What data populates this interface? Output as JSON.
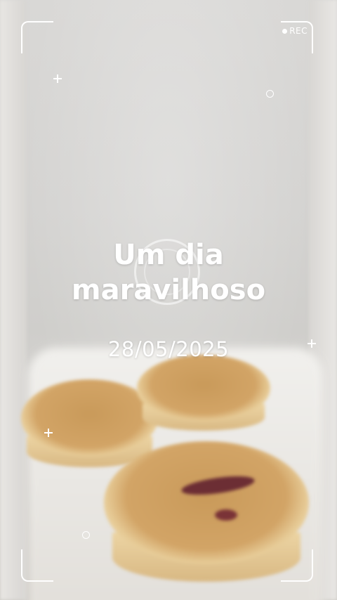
{
  "overlay": {
    "rec_label": "REC",
    "title_line1": "Um dia",
    "title_line2": "maravilhoso",
    "date": "28/05/2025"
  },
  "colors": {
    "text": "#ffffff",
    "crust": "#d2a466",
    "jam": "#6c2e34",
    "background": "#d6d4d1"
  },
  "icons": [
    "rec-dot-icon",
    "plus-icon",
    "circle-icon",
    "focus-ring-icon"
  ]
}
